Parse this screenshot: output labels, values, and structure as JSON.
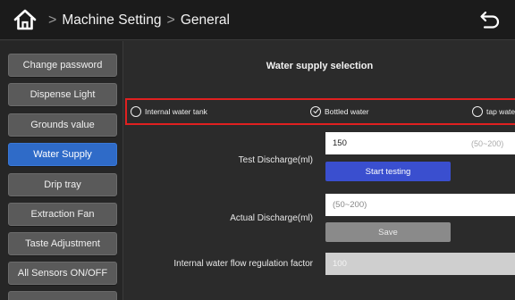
{
  "header": {
    "breadcrumb": [
      "Machine Setting",
      "General"
    ],
    "separator": ">"
  },
  "sidebar": {
    "items": [
      {
        "label": "Change password",
        "active": false
      },
      {
        "label": "Dispense Light",
        "active": false
      },
      {
        "label": "Grounds value",
        "active": false
      },
      {
        "label": "Water Supply",
        "active": true
      },
      {
        "label": "Drip tray",
        "active": false
      },
      {
        "label": "Extraction Fan",
        "active": false
      },
      {
        "label": "Taste Adjustment",
        "active": false
      },
      {
        "label": "All Sensors ON/OFF",
        "active": false
      },
      {
        "label": "",
        "active": false
      }
    ]
  },
  "main": {
    "title": "Water supply selection",
    "options": [
      {
        "label": "Internal water tank",
        "selected": false
      },
      {
        "label": "Bottled water",
        "selected": true
      },
      {
        "label": "tap water",
        "selected": false
      }
    ],
    "test_discharge": {
      "label": "Test Discharge(ml)",
      "value": "150",
      "range": "(50~200)",
      "button": "Start testing"
    },
    "actual_discharge": {
      "label": "Actual Discharge(ml)",
      "placeholder": "(50~200)",
      "button": "Save"
    },
    "flow_factor": {
      "label": "Internal water flow regulation factor",
      "value": "100"
    }
  },
  "colors": {
    "active": "#2f6bc8",
    "start_button": "#3a4fcf",
    "highlight_border": "#e02020"
  }
}
